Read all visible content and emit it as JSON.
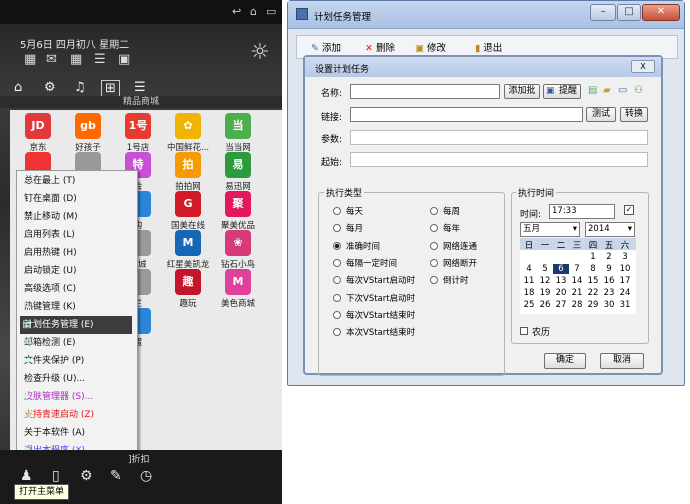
{
  "left": {
    "date_text": "5月6日 四月初八 星期二",
    "banner_label": "精品商城",
    "apps": [
      {
        "label": "京东",
        "icon": "JD",
        "color": "#e4393c"
      },
      {
        "label": "好孩子",
        "icon": "gb",
        "color": "#ff6a00"
      },
      {
        "label": "1号店",
        "icon": "1号",
        "color": "#e63b2e"
      },
      {
        "label": "中国鲜花...",
        "icon": "✿",
        "color": "#f0b400"
      },
      {
        "label": "当当网",
        "icon": "当",
        "color": "#4cae4c"
      },
      {
        "label": "",
        "icon": "",
        "color": "#e33"
      },
      {
        "label": "",
        "icon": "",
        "color": "#999"
      },
      {
        "label": "会",
        "icon": "特",
        "color": "#c94fd8"
      },
      {
        "label": "拍拍网",
        "icon": "拍",
        "color": "#f59a00"
      },
      {
        "label": "易迅网",
        "icon": "易",
        "color": "#2c9b3c"
      },
      {
        "label": "",
        "icon": "",
        "color": "#999"
      },
      {
        "label": "",
        "icon": "",
        "color": "#999"
      },
      {
        "label": "购",
        "icon": "",
        "color": "#2b86d9"
      },
      {
        "label": "国美在线",
        "icon": "G",
        "color": "#d11c27"
      },
      {
        "label": "聚美优品",
        "icon": "聚",
        "color": "#e4185f"
      },
      {
        "label": "",
        "icon": "",
        "color": "#999"
      },
      {
        "label": "",
        "icon": "",
        "color": "#999"
      },
      {
        "label": "商城",
        "icon": "",
        "color": "#999"
      },
      {
        "label": "红星美凯龙",
        "icon": "M",
        "color": "#1667b6"
      },
      {
        "label": "钻石小鸟",
        "icon": "❀",
        "color": "#d63a78"
      },
      {
        "label": "",
        "icon": "",
        "color": "#999"
      },
      {
        "label": "",
        "icon": "",
        "color": "#999"
      },
      {
        "label": "兰",
        "icon": "",
        "color": "#999"
      },
      {
        "label": "趣玩",
        "icon": "趣",
        "color": "#c4162a"
      },
      {
        "label": "美色商城",
        "icon": "M",
        "color": "#e0409a"
      },
      {
        "label": "",
        "icon": "",
        "color": "#999"
      },
      {
        "label": "",
        "icon": "",
        "color": "#999"
      },
      {
        "label": "蛋",
        "icon": "",
        "color": "#2a86d8"
      }
    ],
    "menu": [
      {
        "label": "总在最上 (T)",
        "style": ""
      },
      {
        "label": "钉在桌面 (D)",
        "style": ""
      },
      {
        "label": "禁止移动 (M)",
        "style": ""
      },
      {
        "label": "启用列表 (L)",
        "style": ""
      },
      {
        "label": "启用热键 (H)",
        "style": ""
      },
      {
        "label": "启动锁定 (U)",
        "style": ""
      },
      {
        "label": "高级选项 (C)",
        "style": ""
      },
      {
        "label": "热键管理 (K)",
        "style": ""
      },
      {
        "label": "计划任务管理 (E)",
        "style": "hl"
      },
      {
        "label": "邮箱检测 (E)",
        "style": ""
      },
      {
        "label": "文件夹保护 (P)",
        "style": ""
      },
      {
        "label": "检查升级 (U)...",
        "style": ""
      },
      {
        "label": "皮肤管理器 (S)...",
        "style": "purple"
      },
      {
        "label": "支持青速启动 (Z)",
        "style": "red"
      },
      {
        "label": "关于本软件 (A)",
        "style": ""
      },
      {
        "label": "退出本程序 (X)",
        "style": "blue"
      }
    ],
    "bottom_hint": "]折扣",
    "tooltip": "打开主菜单"
  },
  "main_window": {
    "title": "计划任务管理",
    "toolbar": {
      "add": "添加",
      "delete": "删除",
      "modify": "修改",
      "exit": "退出"
    }
  },
  "dialog": {
    "title": "设置计划任务",
    "close_label": "X",
    "fields": {
      "name": "名称:",
      "link": "链接:",
      "params": "参数:",
      "start": "起始:"
    },
    "buttons": {
      "add_batch": "添加批",
      "remind": "提醒",
      "test": "测试",
      "convert": "转换",
      "ok": "确定",
      "cancel": "取消"
    },
    "exec_type_label": "执行类型",
    "exec_time_label": "执行时间",
    "radios_left": [
      "每天",
      "每月",
      "准确时间",
      "每隔一定时间",
      "每次VStart启动时",
      "下次VStart启动时",
      "每次VStart结束时",
      "本次VStart结束时"
    ],
    "radios_right": [
      "每周",
      "每年",
      "网络连通",
      "网络断开",
      "倒计时"
    ],
    "selected_radio": "准确时间",
    "time_label": "时间:",
    "time_value": "17:33",
    "month_value": "五月",
    "year_value": "2014",
    "weekdays": [
      "日",
      "一",
      "二",
      "三",
      "四",
      "五",
      "六"
    ],
    "cal_rows": [
      [
        "",
        "",
        "",
        "",
        "1",
        "2",
        "3"
      ],
      [
        "4",
        "5",
        "6",
        "7",
        "8",
        "9",
        "10"
      ],
      [
        "11",
        "12",
        "13",
        "14",
        "15",
        "16",
        "17"
      ],
      [
        "18",
        "19",
        "20",
        "21",
        "22",
        "23",
        "24"
      ],
      [
        "25",
        "26",
        "27",
        "28",
        "29",
        "30",
        "31"
      ]
    ],
    "selected_day": "6",
    "lunar_label": "农历"
  }
}
